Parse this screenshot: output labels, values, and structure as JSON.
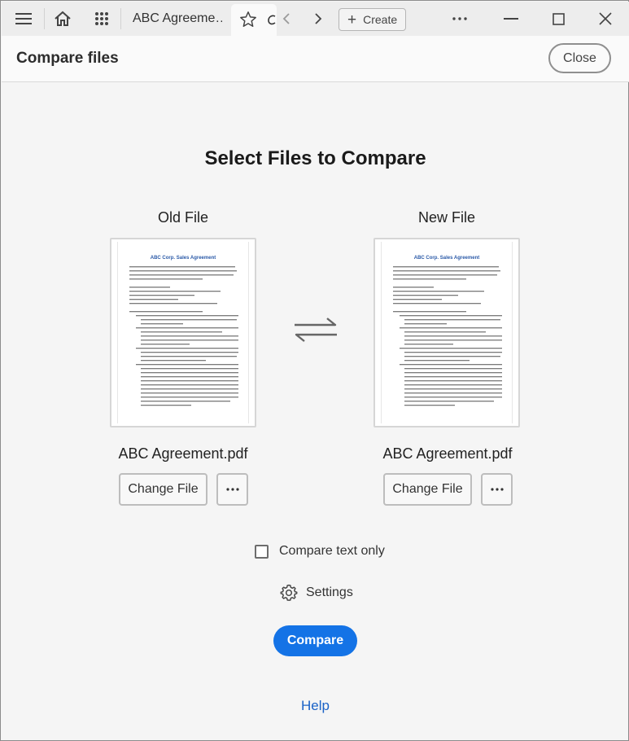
{
  "tabbar": {
    "tab_title": "ABC Agreeme…",
    "create_label": "Create"
  },
  "header": {
    "title": "Compare files",
    "close_label": "Close"
  },
  "main": {
    "title": "Select Files to Compare",
    "old_file": {
      "label": "Old File",
      "file_name": "ABC Agreement.pdf",
      "change_label": "Change File",
      "preview_heading": "ABC Corp. Sales Agreement"
    },
    "new_file": {
      "label": "New File",
      "file_name": "ABC Agreement.pdf",
      "change_label": "Change File",
      "preview_heading": "ABC Corp. Sales Agreement"
    },
    "compare_text_only_label": "Compare text only",
    "compare_text_only_checked": false,
    "settings_label": "Settings",
    "compare_label": "Compare",
    "help_label": "Help"
  },
  "colors": {
    "accent": "#1473e6",
    "link": "#1a62c7"
  }
}
